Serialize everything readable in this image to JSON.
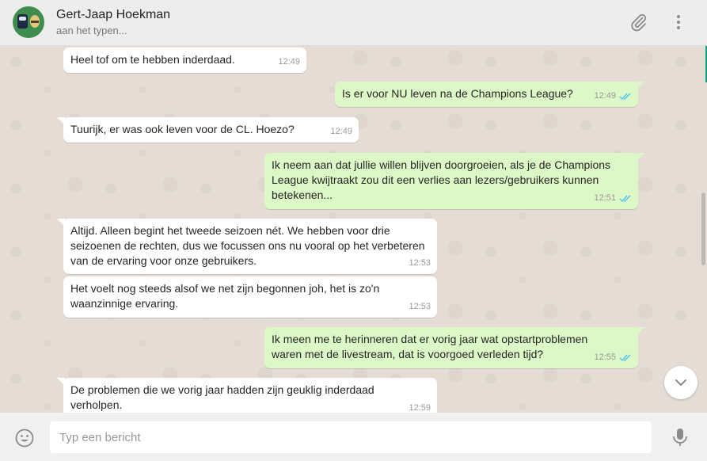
{
  "header": {
    "contact_name": "Gert-Jaap Hoekman",
    "status": "aan het typen..."
  },
  "messages": [
    {
      "dir": "in",
      "text": "Heel tof om te hebben inderdaad.",
      "time": "12:49"
    },
    {
      "dir": "out",
      "text": "Is er voor NU leven na de Champions League?",
      "time": "12:49",
      "ticks": "read"
    },
    {
      "dir": "in",
      "text": "Tuurijk, er was ook leven voor de CL. Hoezo?",
      "time": "12:49"
    },
    {
      "dir": "out",
      "text": "Ik neem aan dat jullie willen blijven doorgroeien, als je de Champions League kwijtraakt zou dit een verlies aan lezers/gebruikers kunnen betekenen...",
      "time": "12:51",
      "ticks": "read"
    },
    {
      "dir": "in",
      "text": "Altijd. Alleen begint het tweede seizoen nét. We hebben voor drie seizoenen de rechten, dus we focussen ons nu vooral op het verbeteren van de ervaring voor onze gebruikers.",
      "time": "12:53"
    },
    {
      "dir": "in",
      "text": "Het voelt nog steeds alsof we net zijn begonnen joh, het is zo'n waanzinnige ervaring.",
      "time": "12:53"
    },
    {
      "dir": "out",
      "text": "Ik meen me te herinneren dat er vorig jaar wat opstartproblemen waren met de livestream, dat is voorgoed verleden tijd?",
      "time": "12:55",
      "ticks": "read"
    },
    {
      "dir": "in",
      "text": "De problemen die we vorig jaar hadden zijn geuklig inderdaad verholpen.",
      "time": "12:59"
    }
  ],
  "composer": {
    "placeholder": "Typ een bericht"
  },
  "icons": {
    "attach": "paperclip-icon",
    "menu": "kebab-menu-icon",
    "emoji": "smiley-icon",
    "mic": "microphone-icon",
    "scroll": "chevron-down-icon"
  },
  "colors": {
    "incoming_bubble": "#ffffff",
    "outgoing_bubble": "#dcf8c6",
    "read_ticks": "#4fc3f7",
    "chat_background": "#e5ddd5"
  }
}
